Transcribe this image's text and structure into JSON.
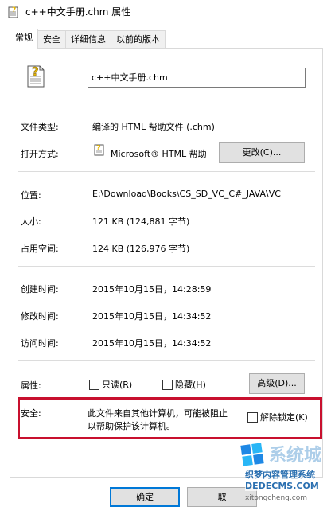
{
  "window": {
    "title": "c++中文手册.chm 属性"
  },
  "tabs": [
    "常规",
    "安全",
    "详细信息",
    "以前的版本"
  ],
  "general": {
    "filename": "c++中文手册.chm",
    "file_type_label": "文件类型:",
    "file_type_value": "编译的 HTML 帮助文件 (.chm)",
    "opens_with_label": "打开方式:",
    "opens_with_value": "Microsoft® HTML 帮助",
    "change_button": "更改(C)...",
    "location_label": "位置:",
    "location_value": "E:\\Download\\Books\\CS_SD_VC_C#_JAVA\\VC",
    "size_label": "大小:",
    "size_value": "121 KB (124,881 字节)",
    "size_on_disk_label": "占用空间:",
    "size_on_disk_value": "124 KB (126,976 字节)",
    "created_label": "创建时间:",
    "created_value": "2015年10月15日，14:28:59",
    "modified_label": "修改时间:",
    "modified_value": "2015年10月15日，14:34:52",
    "accessed_label": "访问时间:",
    "accessed_value": "2015年10月15日，14:34:52",
    "attributes_label": "属性:",
    "readonly_label": "只读(R)",
    "hidden_label": "隐藏(H)",
    "advanced_button": "高级(D)...",
    "security_label": "安全:",
    "security_line1": "此文件来自其他计算机，可能被阻止",
    "security_line2": "以帮助保护该计算机。",
    "unblock_label": "解除锁定(K)"
  },
  "footer": {
    "ok_button": "确定",
    "cancel_button": "取"
  },
  "watermark": {
    "brand": "系统城",
    "line2": "织梦内容管理系统",
    "line3": "DEDECMS.COM",
    "line4": "xitongcheng.com"
  }
}
